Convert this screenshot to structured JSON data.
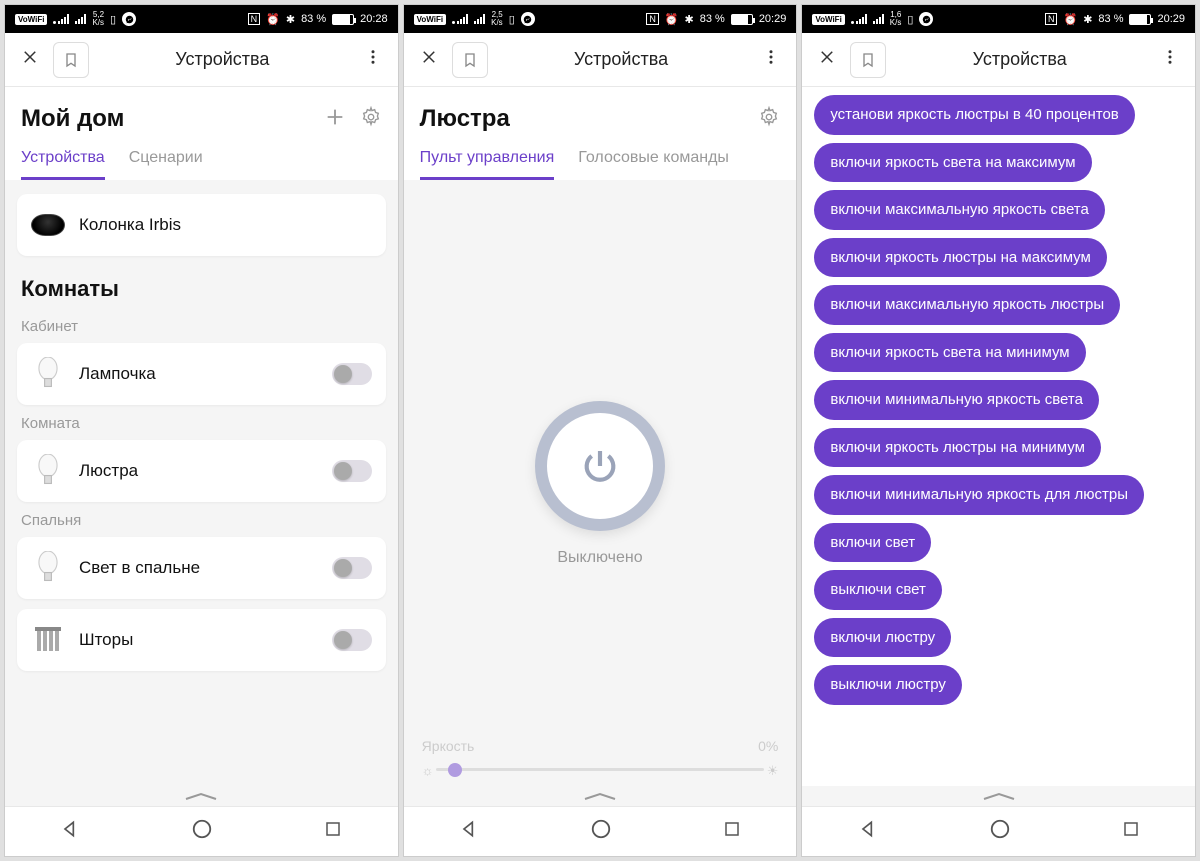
{
  "screens": [
    {
      "status": {
        "vowifi": "VoWiFi",
        "speed_val": "5,2",
        "speed_unit": "K/s",
        "nfc": "N",
        "bt": "83 %",
        "time": "20:28"
      },
      "browser": {
        "title": "Устройства"
      },
      "header": {
        "title": "Мой дом"
      },
      "tabs": {
        "active": "Устройства",
        "inactive": "Сценарии"
      },
      "speaker": {
        "name": "Колонка Irbis"
      },
      "rooms_title": "Комнаты",
      "rooms": [
        {
          "name": "Кабинет",
          "devices": [
            {
              "name": "Лампочка",
              "type": "bulb"
            }
          ]
        },
        {
          "name": "Комната",
          "devices": [
            {
              "name": "Люстра",
              "type": "bulb"
            }
          ]
        },
        {
          "name": "Спальня",
          "devices": [
            {
              "name": "Свет в спальне",
              "type": "bulb"
            },
            {
              "name": "Шторы",
              "type": "curtain"
            }
          ]
        }
      ]
    },
    {
      "status": {
        "vowifi": "VoWiFi",
        "speed_val": "2,5",
        "speed_unit": "K/s",
        "nfc": "N",
        "bt": "83 %",
        "time": "20:29"
      },
      "browser": {
        "title": "Устройства"
      },
      "header": {
        "title": "Люстра"
      },
      "tabs": {
        "active": "Пульт управления",
        "inactive": "Голосовые команды"
      },
      "power_status": "Выключено",
      "brightness": {
        "label": "Яркость",
        "value": "0%"
      }
    },
    {
      "status": {
        "vowifi": "VoWiFi",
        "speed_val": "1,6",
        "speed_unit": "K/s",
        "nfc": "N",
        "bt": "83 %",
        "time": "20:29"
      },
      "browser": {
        "title": "Устройства"
      },
      "commands": [
        "установи яркость люстры в 40 процентов",
        "включи яркость света на максимум",
        "включи максимальную яркость света",
        "включи яркость люстры на максимум",
        "включи максимальную яркость люстры",
        "включи яркость света на минимум",
        "включи минимальную яркость света",
        "включи яркость люстры на минимум",
        "включи минимальную яркость для люстры",
        "включи свет",
        "выключи свет",
        "включи люстру",
        "выключи люстру"
      ]
    }
  ]
}
